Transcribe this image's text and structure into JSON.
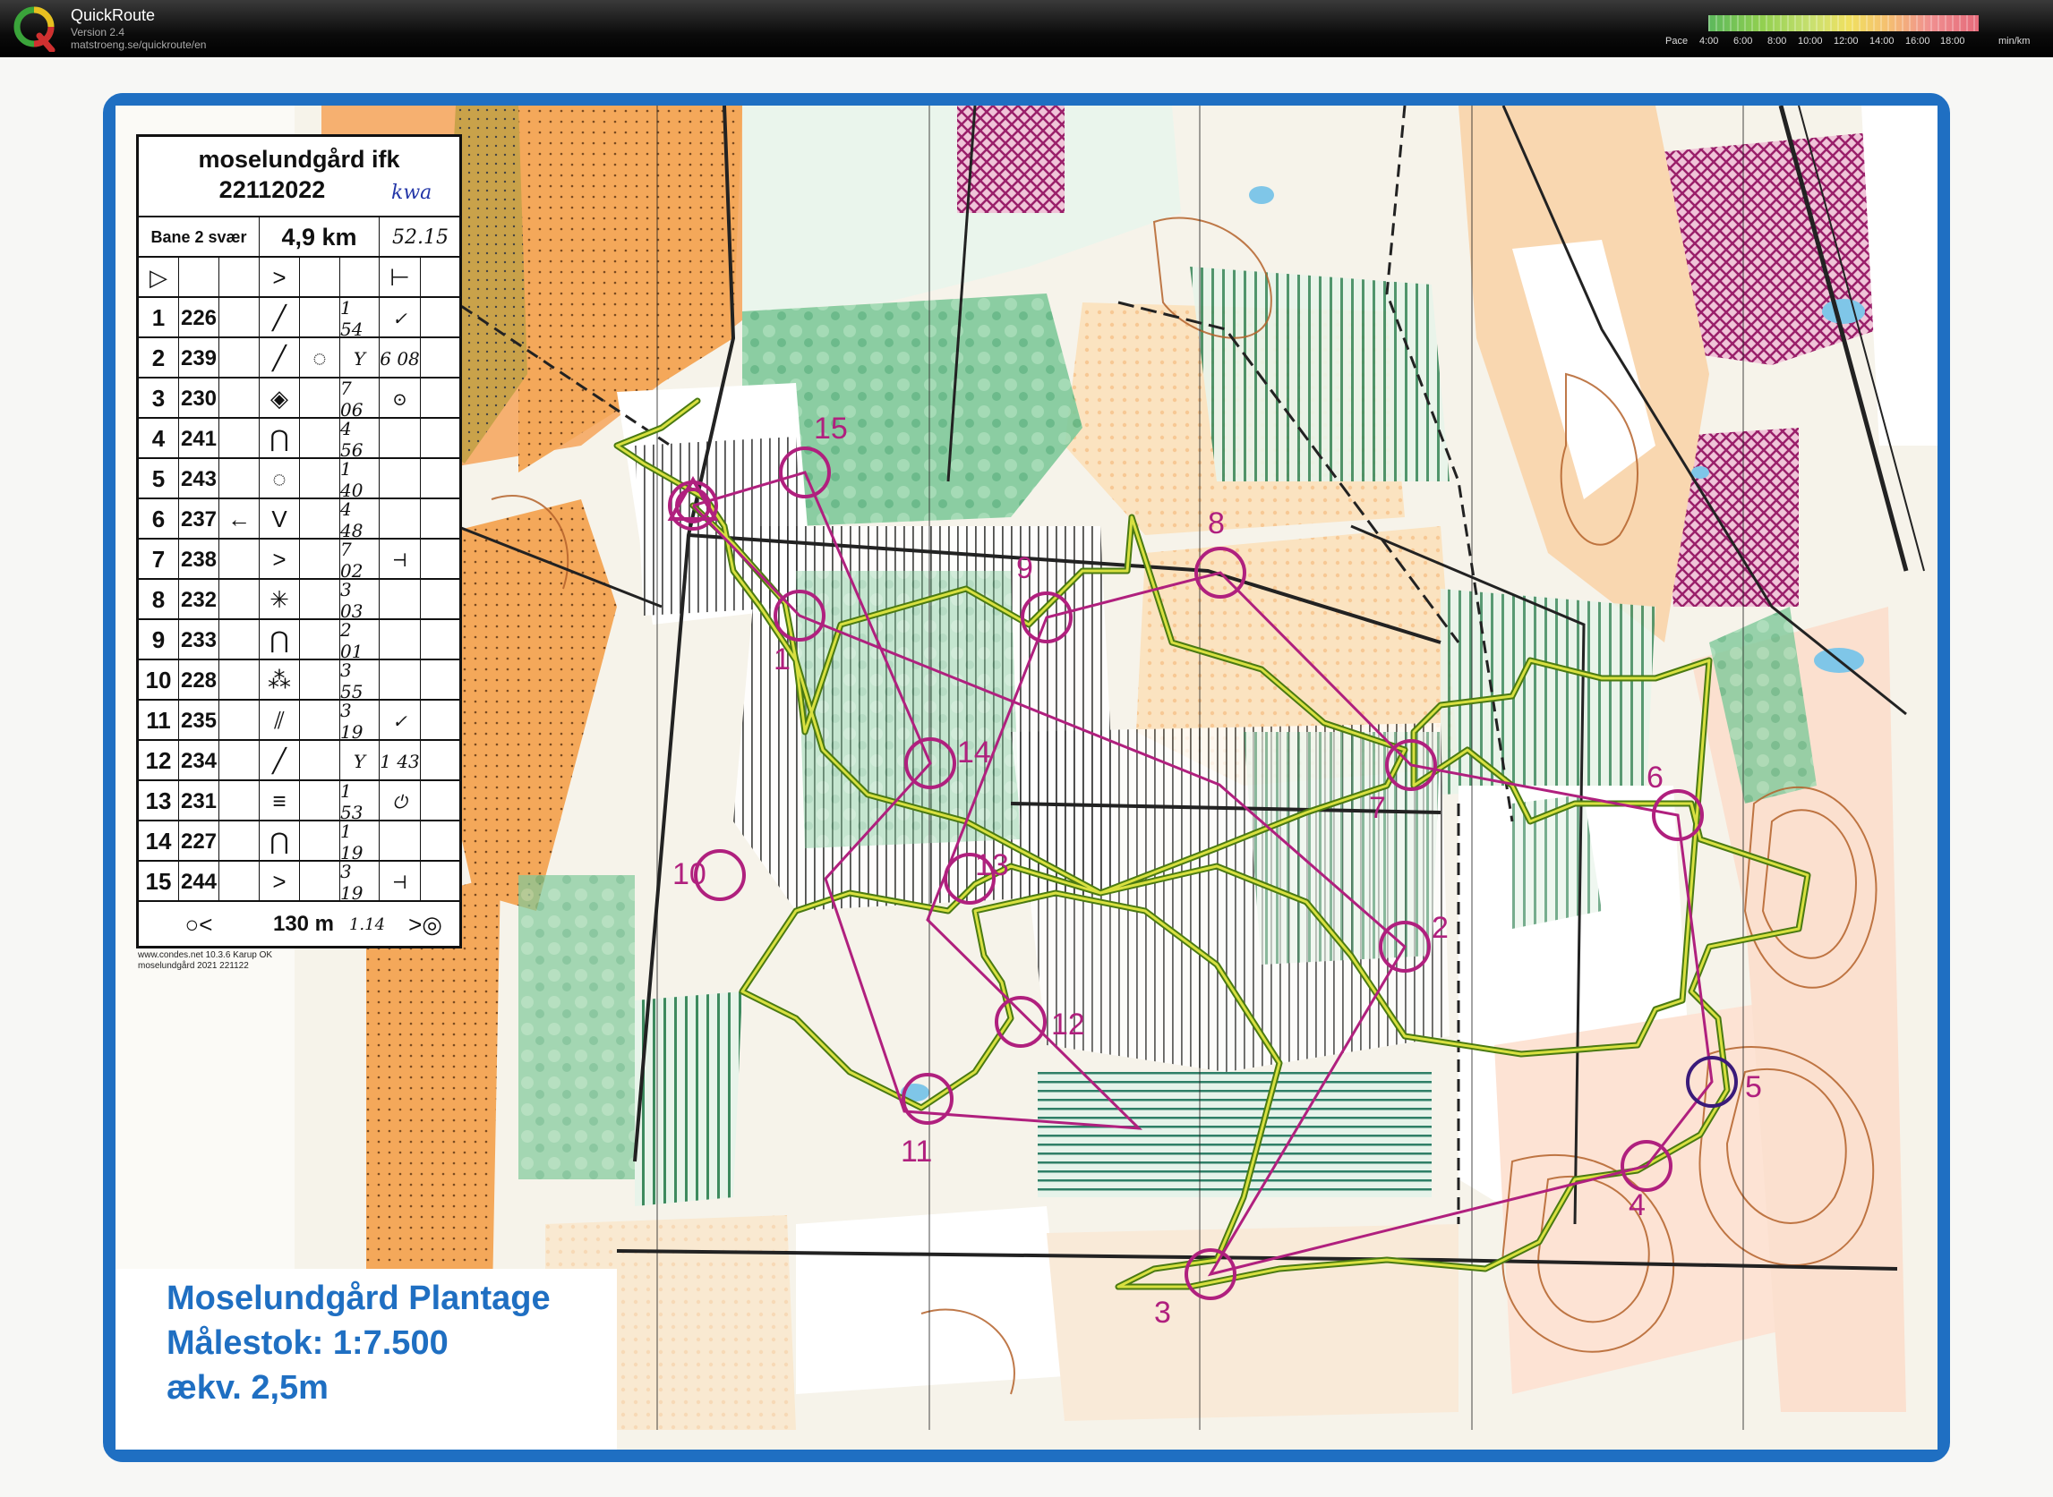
{
  "app": {
    "title": "QuickRoute",
    "version": "Version 2.4",
    "url": "matstroeng.se/quickroute/en",
    "logo_letter": "Q"
  },
  "pace_legend": {
    "label": "Pace",
    "ticks": [
      "4:00",
      "6:00",
      "8:00",
      "10:00",
      "12:00",
      "14:00",
      "16:00",
      "18:00"
    ],
    "unit": "min/km"
  },
  "control_card": {
    "event": "moselundgård ifk",
    "date": "22112022",
    "handwritten_initials": "kwa",
    "course": "Bane 2 svær",
    "length": "4,9 km",
    "handwritten_total": "52.15",
    "start_symbol": "▷",
    "finish_distance": "130 m",
    "finish_handwritten": "1.14",
    "rows": [
      {
        "n": "1",
        "code": "226",
        "d": "",
        "c": "╱",
        "e": "",
        "split": "1 54",
        "g": "✓"
      },
      {
        "n": "2",
        "code": "239",
        "d": "",
        "c": "╱",
        "e": "◌",
        "split": "Y",
        "g": "6 08"
      },
      {
        "n": "3",
        "code": "230",
        "d": "",
        "c": "◈",
        "e": "",
        "split": "7 06",
        "g": "⊙"
      },
      {
        "n": "4",
        "code": "241",
        "d": "",
        "c": "⋂",
        "e": "",
        "split": "4 56",
        "g": ""
      },
      {
        "n": "5",
        "code": "243",
        "d": "",
        "c": "◌",
        "e": "",
        "split": "1 40",
        "g": ""
      },
      {
        "n": "6",
        "code": "237",
        "d": "←",
        "c": "V",
        "e": "",
        "split": "4 48",
        "g": ""
      },
      {
        "n": "7",
        "code": "238",
        "d": "",
        "c": ">",
        "e": "",
        "split": "7 02",
        "g": "⊣"
      },
      {
        "n": "8",
        "code": "232",
        "d": "",
        "c": "✳",
        "e": "",
        "split": "3 03",
        "g": ""
      },
      {
        "n": "9",
        "code": "233",
        "d": "",
        "c": "⋂",
        "e": "",
        "split": "2 01",
        "g": ""
      },
      {
        "n": "10",
        "code": "228",
        "d": "",
        "c": "⁂",
        "e": "",
        "split": "3 55",
        "g": ""
      },
      {
        "n": "11",
        "code": "235",
        "d": "",
        "c": "⫽",
        "e": "",
        "split": "3 19",
        "g": "✓"
      },
      {
        "n": "12",
        "code": "234",
        "d": "",
        "c": "╱",
        "e": "",
        "split": "Y",
        "g": "1 43"
      },
      {
        "n": "13",
        "code": "231",
        "d": "",
        "c": "≡",
        "e": "",
        "split": "1 53",
        "g": "⏻"
      },
      {
        "n": "14",
        "code": "227",
        "d": "",
        "c": "⋂",
        "e": "",
        "split": "1 19",
        "g": ""
      },
      {
        "n": "15",
        "code": "244",
        "d": "",
        "c": ">",
        "e": "",
        "split": "3 19",
        "g": "⊣"
      }
    ],
    "footer_line1": "www.condes.net 10.3.6 Karup OK",
    "footer_line2": "moselundgård 2021 221122"
  },
  "map": {
    "name": "Moselundgård Plantage",
    "scale": "Målestok: 1:7.500",
    "contour": "ækv. 2,5m",
    "control_labels": [
      "1",
      "2",
      "3",
      "4",
      "5",
      "6",
      "7",
      "8",
      "9",
      "10",
      "11",
      "12",
      "13",
      "14",
      "15"
    ],
    "colors": {
      "frame": "#1f6fc2",
      "course": "#b0207e",
      "open_land": "#f2a24a",
      "forest_green": "#55b07a",
      "route": "#6ea81a"
    }
  }
}
